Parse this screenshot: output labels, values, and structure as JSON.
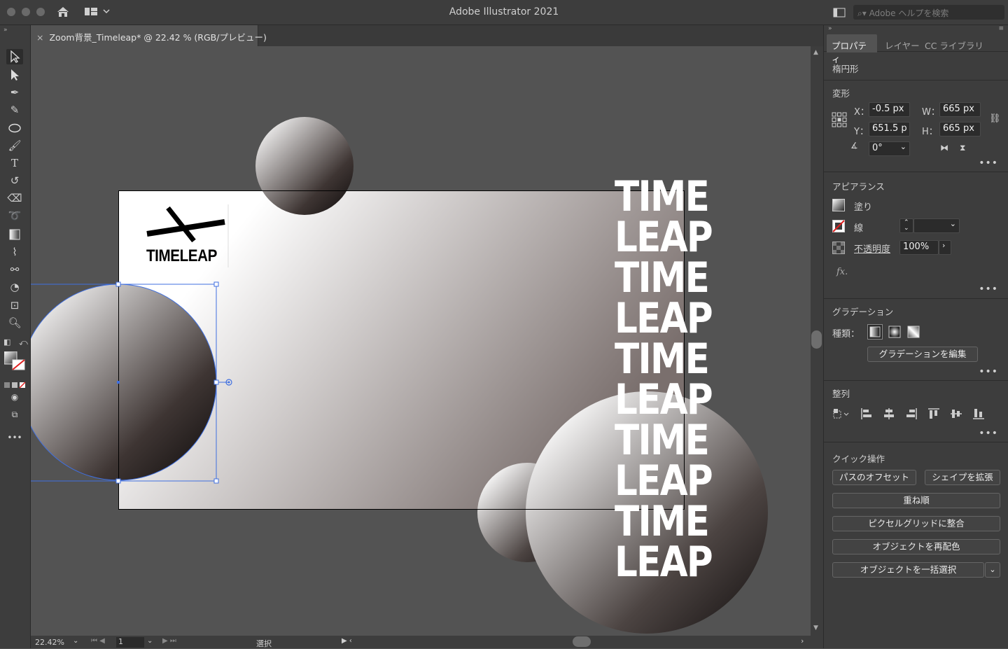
{
  "app": {
    "title": "Adobe Illustrator 2021",
    "search_placeholder": "Adobe ヘルプを検索"
  },
  "document": {
    "tab_title": "Zoom背景_Timeleap* @ 22.42 % (RGB/プレビュー)",
    "close_glyph": "×"
  },
  "artwork": {
    "logo_text": "TIMELEAP",
    "repeated_words": [
      "TIME",
      "LEAP",
      "TIME",
      "LEAP",
      "TIME",
      "LEAP",
      "TIME",
      "LEAP",
      "TIME",
      "LEAP"
    ]
  },
  "status": {
    "zoom": "22.42%",
    "artboard": "1",
    "tool": "選択"
  },
  "panel": {
    "tabs": [
      "プロパティ",
      "レイヤー",
      "CC ライブラリ"
    ],
    "object_type": "楕円形",
    "transform": {
      "title": "変形",
      "x_label": "X：",
      "x": "-0.5 px",
      "y_label": "Y：",
      "y": "651.5 p",
      "w_label": "W：",
      "w": "665 px",
      "h_label": "H：",
      "h": "665 px",
      "angle": "0°"
    },
    "appearance": {
      "title": "アピアランス",
      "fill": "塗り",
      "stroke": "線",
      "opacity_label": "不透明度",
      "opacity": "100%",
      "fx": "fx."
    },
    "gradient": {
      "title": "グラデーション",
      "type_label": "種類：",
      "edit_button": "グラデーションを編集"
    },
    "align": {
      "title": "整列"
    },
    "quick_actions": {
      "title": "クイック操作",
      "offset_path": "パスのオフセット",
      "expand_shape": "シェイプを拡張",
      "arrange": "重ね順",
      "pixel_grid": "ピクセルグリッドに整合",
      "recolor": "オブジェクトを再配色",
      "select_all": "オブジェクトを一括選択"
    }
  },
  "colors": {
    "accent_selection": "#3f6fe0",
    "panel_bg": "#3d3d3d",
    "canvas_bg": "#535353"
  }
}
